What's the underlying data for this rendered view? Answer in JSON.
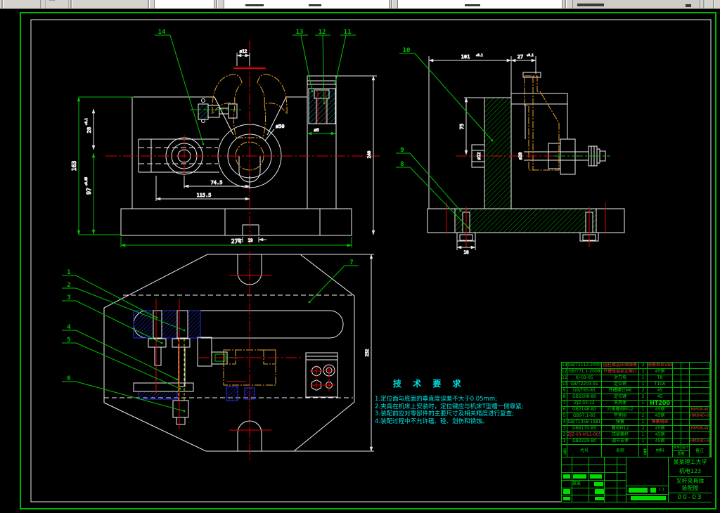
{
  "tech": {
    "title": "技 术 要 求",
    "items": [
      "1.定位面与底面的垂直度误差不大于0.05mm;",
      "2.夹具在机床上安装时，定位键应与机床T型槽一侧靠紧;",
      "3.装配前应对零部件的主要尺寸及相关精度进行复查;",
      "4.装配过程中不允许磕、碰、划伤和锈蚀。"
    ]
  },
  "dims": {
    "d163": "163",
    "d97": "97",
    "d97t": "+0.05",
    "d28": "28",
    "d28t": "+0.1",
    "d274": "274",
    "d19": "19",
    "d74": "74.5",
    "d115": "115.5",
    "d12": "ø12",
    "d50": "ø50",
    "d240": "240",
    "d6": "ø6",
    "d101": "101",
    "d101t": "+0.1",
    "d27": "27",
    "d27t": "+0.1",
    "d75": "75",
    "s12": "ø12",
    "s20": "ø20",
    "d18": "18",
    "d232": "232"
  },
  "balloons": [
    "1",
    "2",
    "3",
    "4",
    "5",
    "6",
    "7",
    "8",
    "9",
    "10",
    "11",
    "12",
    "13",
    "14"
  ],
  "bom": {
    "header": {
      "no": "序号",
      "code": "代号",
      "name": "名称",
      "qty": "数量",
      "material": "材料",
      "w1": "单件",
      "w2": "总计",
      "weight": "重量",
      "remark": "备注"
    },
    "rows": [
      {
        "no": "13",
        "code": "GB/T2112-2000",
        "name": "圆柱螺旋压缩弹簧",
        "qty": "2",
        "material": "弹簧钢丝VB级4级",
        "remark": "",
        "red": [
          "name",
          "material"
        ]
      },
      {
        "no": "12",
        "code": "GB/T71.1-2008",
        "name": "开槽锥端紧定螺钉",
        "qty": "2",
        "material": "45钢",
        "remark": "",
        "red": [
          "name"
        ]
      },
      {
        "no": "11",
        "code": "XJ-03-05",
        "name": "对刀块",
        "qty": "1",
        "material": "T8",
        "remark": "",
        "red": []
      },
      {
        "no": "10",
        "code": "GB/T2203-91",
        "name": "定位销",
        "qty": "1",
        "material": "T10A",
        "remark": "",
        "red": []
      },
      {
        "no": "9",
        "code": "GB/T65-85",
        "name": "开槽螺钉M6",
        "qty": "2",
        "material": "45",
        "remark": "",
        "red": []
      },
      {
        "no": "8",
        "code": "GB2208-80",
        "name": "定位键",
        "qty": "2",
        "material": "45",
        "remark": "",
        "red": []
      },
      {
        "no": "7",
        "code": "ZJZ-03-12",
        "name": "夹具体",
        "qty": "1",
        "material": "HT200",
        "remark": "",
        "red": [],
        "mbig": true
      },
      {
        "no": "6",
        "code": "GB2148-80",
        "name": "六角螺母M12",
        "qty": "1",
        "material": "45钢",
        "remark": "HM08-W",
        "red": [
          "remark"
        ]
      },
      {
        "no": "5",
        "code": "GB97.1-85",
        "name": "平垫圈",
        "qty": "2",
        "material": "45钢",
        "remark": "HM040-H",
        "red": [
          "remark"
        ]
      },
      {
        "no": "4",
        "code": "GB/T1358-1981",
        "name": "弹簧",
        "qty": "1",
        "material": "弹簧钢丝",
        "remark": "",
        "red": [
          "material"
        ]
      },
      {
        "no": "3",
        "code": "GB6170-85",
        "name": "螺母M12",
        "qty": "2",
        "material": "45钢",
        "remark": "HM08-W",
        "red": [
          "remark"
        ]
      },
      {
        "no": "2",
        "code": "ZJZ-03-M12-005",
        "name": "压紧螺杆",
        "qty": "1",
        "material": "45钢",
        "remark": "",
        "red": [
          "code"
        ]
      },
      {
        "no": "1",
        "code": "GB2229-80",
        "name": "调节支承",
        "qty": "1",
        "material": "45钢",
        "remark": "HM040-H",
        "red": [
          "remark"
        ]
      }
    ]
  },
  "title_block": {
    "school": "某某理工大学",
    "class_name": "机电123",
    "part": "叉杆夹具体",
    "doc": "装配图",
    "number": "00-03",
    "sig": "某某",
    "scale": "1:1"
  },
  "colors": {
    "dim_green": "#00c000",
    "geometry_white": "#f0f0f0",
    "centerline_red": "#e00000",
    "tech_cyan": "#00e2e2",
    "phantom_orange": "#e8a030",
    "section_blue": "#2830d8",
    "table_green": "#00dc00"
  }
}
